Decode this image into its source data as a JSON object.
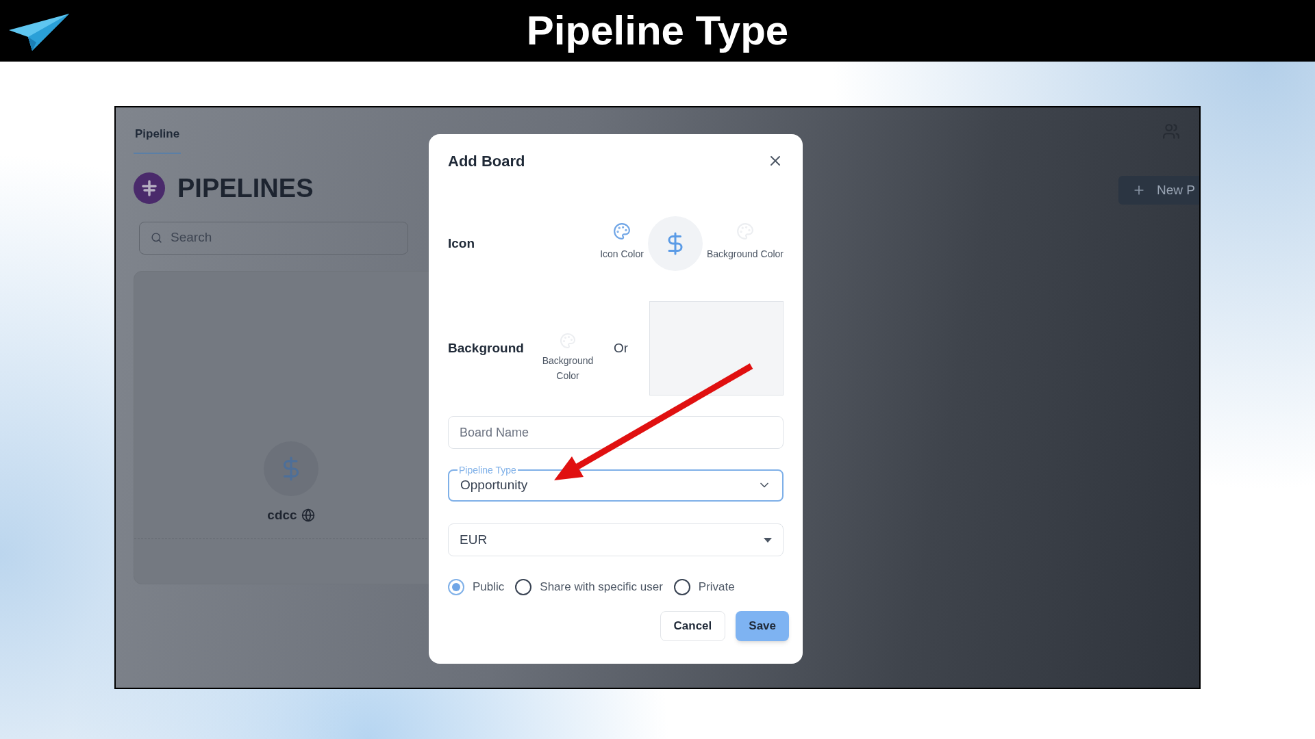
{
  "banner": {
    "title": "Pipeline Type"
  },
  "app": {
    "tabs": [
      {
        "label": "Pipeline",
        "selected": true
      }
    ],
    "heading": "PIPELINES",
    "search": {
      "placeholder": "Search"
    },
    "boards": [
      {
        "name": "cdcc"
      }
    ],
    "new_button": "New P"
  },
  "dialog": {
    "title": "Add Board",
    "icon_row": {
      "label": "Icon",
      "icon_color_label": "Icon Color",
      "background_color_label": "Background Color"
    },
    "background_row": {
      "label": "Background",
      "color_label": "Background Color",
      "or": "Or"
    },
    "fields": [
      {
        "kind": "text",
        "placeholder": "Board Name"
      },
      {
        "kind": "dropdown",
        "label": "Pipeline Type",
        "value": "Opportunity",
        "focused": true
      },
      {
        "kind": "select",
        "value": "EUR",
        "focused": false
      }
    ],
    "visibility": [
      {
        "label": "Public",
        "selected": true
      },
      {
        "label": "Share with specific user",
        "selected": false
      },
      {
        "label": "Private",
        "selected": false
      }
    ],
    "buttons": [
      {
        "label": "Cancel",
        "kind": "secondary"
      },
      {
        "label": "Save",
        "kind": "primary"
      }
    ]
  }
}
